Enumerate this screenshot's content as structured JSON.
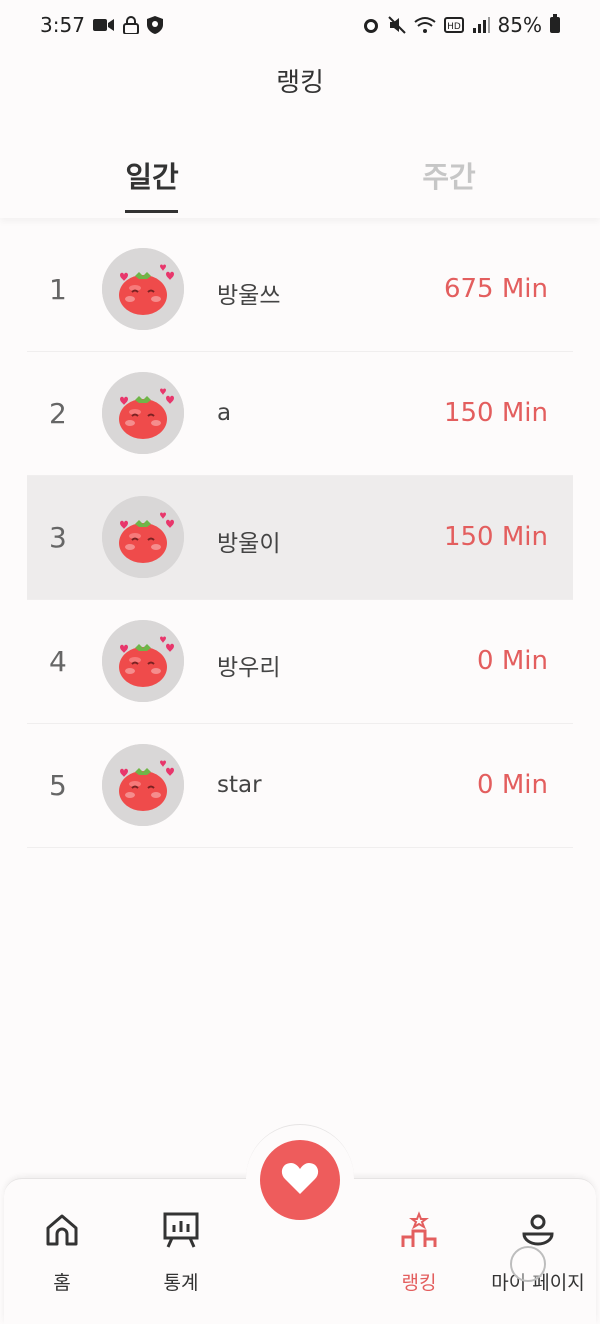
{
  "status": {
    "time": "3:57",
    "battery": "85%"
  },
  "header": {
    "title": "랭킹"
  },
  "tabs": {
    "daily": "일간",
    "weekly": "주간"
  },
  "ranking": [
    {
      "rank": "1",
      "name": "방울쓰",
      "time": "675 Min",
      "highlight": false
    },
    {
      "rank": "2",
      "name": "a",
      "time": "150 Min",
      "highlight": false
    },
    {
      "rank": "3",
      "name": "방울이",
      "time": "150 Min",
      "highlight": true
    },
    {
      "rank": "4",
      "name": "방우리",
      "time": "0 Min",
      "highlight": false
    },
    {
      "rank": "5",
      "name": "star",
      "time": "0 Min",
      "highlight": false
    }
  ],
  "nav": {
    "home": "홈",
    "stats": "통계",
    "ranking": "랭킹",
    "mypage": "마이 페이지"
  },
  "colors": {
    "accent": "#e35e5e",
    "fab": "#ee5c5c",
    "highlight_row": "#eeecec"
  }
}
